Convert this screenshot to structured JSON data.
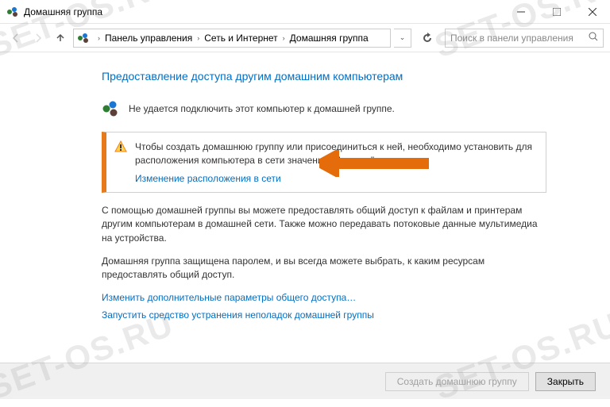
{
  "window": {
    "title": "Домашняя группа"
  },
  "breadcrumb": {
    "items": [
      "Панель управления",
      "Сеть и Интернет",
      "Домашняя группа"
    ]
  },
  "search": {
    "placeholder": "Поиск в панели управления"
  },
  "page": {
    "heading": "Предоставление доступа другим домашним компьютерам",
    "status": "Не удается подключить этот компьютер к домашней группе.",
    "infobox": {
      "text": "Чтобы создать домашнюю группу или присоединиться к ней, необходимо установить для расположения компьютера в сети значение \"Частная\".",
      "link": "Изменение расположения в сети"
    },
    "para1": "С помощью домашней группы вы можете предоставлять общий доступ к файлам и принтерам другим компьютерам в домашней сети. Также можно передавать потоковые данные мультимедиа на устройства.",
    "para2": "Домашняя группа защищена паролем, и вы всегда можете выбрать, к каким ресурсам предоставлять общий доступ.",
    "link1": "Изменить дополнительные параметры общего доступа…",
    "link2": "Запустить средство устранения неполадок домашней группы"
  },
  "footer": {
    "create": "Создать домашнюю группу",
    "close": "Закрыть"
  },
  "watermark": "SET-OS.RU"
}
